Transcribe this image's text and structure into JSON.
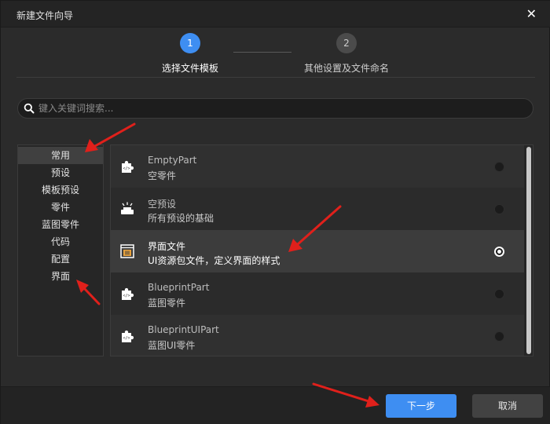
{
  "window": {
    "title": "新建文件向导"
  },
  "steps": [
    {
      "number": "1",
      "label": "选择文件模板"
    },
    {
      "number": "2",
      "label": "其他设置及文件命名"
    }
  ],
  "search": {
    "placeholder": "键入关键词搜索..."
  },
  "sidebar": {
    "items": [
      {
        "label": "常用"
      },
      {
        "label": "预设"
      },
      {
        "label": "模板预设"
      },
      {
        "label": "零件"
      },
      {
        "label": "蓝图零件"
      },
      {
        "label": "代码"
      },
      {
        "label": "配置"
      },
      {
        "label": "界面"
      }
    ],
    "active_index": 0
  },
  "templates": [
    {
      "title": "EmptyPart",
      "subtitle": "空零件",
      "icon": "puzzle-code-icon",
      "selected": false
    },
    {
      "title": "空预设",
      "subtitle": "所有预设的基础",
      "icon": "preset-icon",
      "selected": false
    },
    {
      "title": "界面文件",
      "subtitle": "UI资源包文件，定义界面的样式",
      "icon": "ui-file-icon",
      "selected": true
    },
    {
      "title": "BlueprintPart",
      "subtitle": "蓝图零件",
      "icon": "puzzle-code-icon",
      "selected": false
    },
    {
      "title": "BlueprintUIPart",
      "subtitle": "蓝图UI零件",
      "icon": "puzzle-code-icon",
      "selected": false
    }
  ],
  "footer": {
    "next_label": "下一步",
    "cancel_label": "取消"
  },
  "colors": {
    "accent": "#3e8ef2",
    "annotation_arrow": "#e0201b",
    "ui_icon_orange": "#e8a23c"
  }
}
